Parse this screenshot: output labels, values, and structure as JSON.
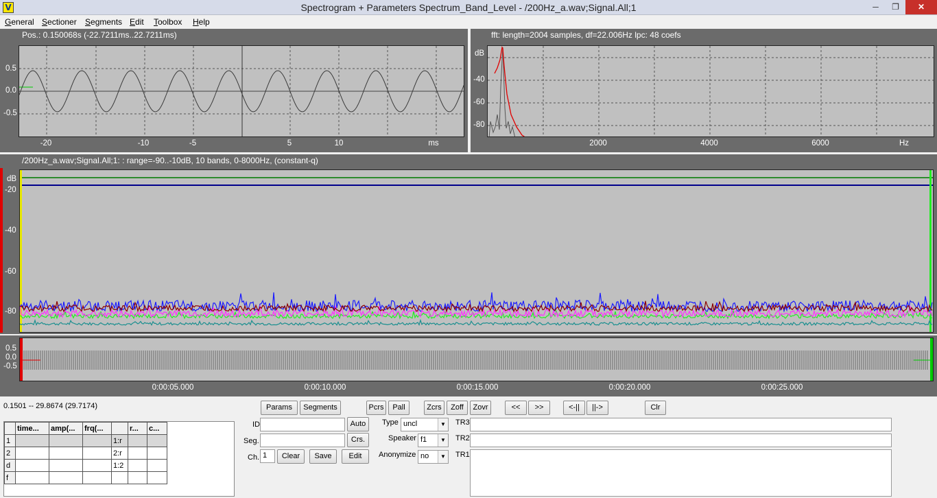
{
  "window": {
    "title": "Spectrogram + Parameters Spectrum_Band_Level - /200Hz_a.wav;Signal.All;1",
    "logo_letter": "V",
    "minimize": "─",
    "maximize": "❐",
    "close": "✕"
  },
  "menu": [
    "General",
    "Sectioner",
    "Segments",
    "Edit",
    "Toolbox",
    "Help"
  ],
  "waveform_panel": {
    "title": "Pos.: 0.150068s (-22.7211ms..22.7211ms)",
    "y_ticks": [
      "0.5",
      "0.0",
      "-0.5"
    ],
    "x_ticks": [
      "-20",
      "-10",
      "-5",
      "5",
      "10"
    ],
    "x_unit": "ms"
  },
  "fft_panel": {
    "title": "fft: length=2004 samples, df=22.006Hz lpc: 48 coefs",
    "y_unit": "dB",
    "y_ticks": [
      "-40",
      "-60",
      "-80"
    ],
    "x_ticks": [
      "2000",
      "4000",
      "6000"
    ],
    "x_unit": "Hz"
  },
  "band_panel": {
    "title": "/200Hz_a.wav;Signal.All;1: : range=-90..-10dB, 10 bands, 0-8000Hz, (constant-q)",
    "y_unit": "dB",
    "y_ticks": [
      "-20",
      "-40",
      "-60",
      "-80"
    ],
    "colors": {
      "green": "#2e8b2e",
      "navy": "#00008b",
      "maroon": "#8b0000",
      "magenta": "#ff30ff",
      "blue": "#1a1aff",
      "lime": "#22ee22",
      "teal": "#1a8f8f"
    }
  },
  "overview_panel": {
    "y_ticks": [
      "0.5",
      "0.0",
      "-0.5"
    ],
    "time_ticks": [
      "0:00:05.000",
      "0:00:10.000",
      "0:00:15.000",
      "0:00:20.000",
      "0:00:25.000"
    ]
  },
  "bottom": {
    "selection": "0.1501 -- 29.8674 (29.7174)",
    "table": {
      "headers": [
        "",
        "time...",
        "amp(...",
        "frq(...",
        "",
        "r...",
        "c..."
      ],
      "rows": [
        [
          "1",
          "",
          "",
          "",
          "1:r",
          "",
          ""
        ],
        [
          "2",
          "",
          "",
          "",
          "2:r",
          "",
          ""
        ],
        [
          "d",
          "",
          "",
          "",
          "1:2",
          "",
          ""
        ],
        [
          "f",
          "",
          "",
          "",
          "",
          "",
          ""
        ]
      ]
    },
    "buttons": {
      "params": "Params",
      "segments": "Segments",
      "pcrs": "Pcrs",
      "pall": "Pall",
      "zcrs": "Zcrs",
      "zoff": "Zoff",
      "zovr": "Zovr",
      "prev": "<<",
      "next": ">>",
      "shrink": "<-||",
      "expand": "||->",
      "clr": "Clr",
      "auto": "Auto",
      "crs": "Crs.",
      "clear": "Clear",
      "save": "Save",
      "edit": "Edit"
    },
    "labels": {
      "id": "ID",
      "seg": "Seg.",
      "ch": "Ch.",
      "type": "Type",
      "speaker": "Speaker",
      "anonymize": "Anonymize",
      "tr3": "TR3",
      "tr2": "TR2",
      "tr1": "TR1"
    },
    "fields": {
      "id": "",
      "seg": "",
      "ch": "1",
      "type": "uncl",
      "speaker": "f1",
      "anonymize": "no",
      "tr3": "",
      "tr2": "",
      "tr1": ""
    }
  }
}
